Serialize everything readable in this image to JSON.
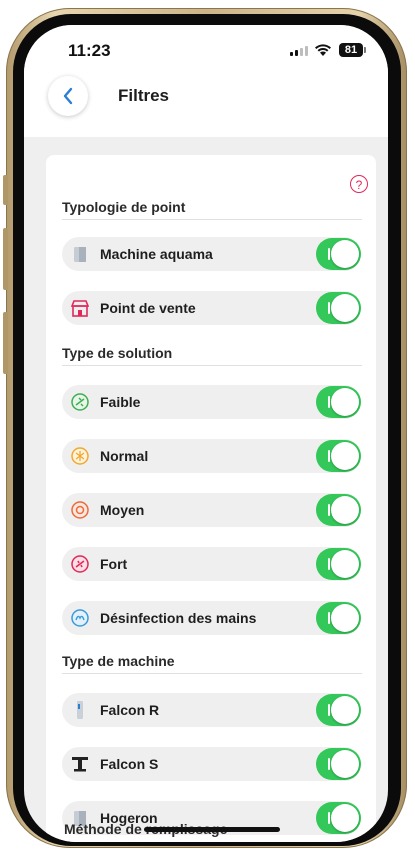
{
  "status_bar": {
    "time": "11:23",
    "battery": "81"
  },
  "header": {
    "title": "Filtres"
  },
  "sections": [
    {
      "title": "Typologie de point",
      "items": [
        {
          "label": "Machine aquama",
          "icon": "machine-icon",
          "on": true
        },
        {
          "label": "Point de vente",
          "icon": "store-icon",
          "on": true
        }
      ]
    },
    {
      "title": "Type de solution",
      "items": [
        {
          "label": "Faible",
          "icon": "faible-icon",
          "on": true
        },
        {
          "label": "Normal",
          "icon": "normal-icon",
          "on": true
        },
        {
          "label": "Moyen",
          "icon": "moyen-icon",
          "on": true
        },
        {
          "label": "Fort",
          "icon": "fort-icon",
          "on": true
        },
        {
          "label": "Désinfection des mains",
          "icon": "hands-icon",
          "on": true
        }
      ]
    },
    {
      "title": "Type de machine",
      "items": [
        {
          "label": "Falcon R",
          "icon": "falcon-r-icon",
          "on": true
        },
        {
          "label": "Falcon S",
          "icon": "falcon-s-icon",
          "on": true
        },
        {
          "label": "Hogeron",
          "icon": "hogeron-icon",
          "on": true
        }
      ]
    },
    {
      "title": "Méthode de remplissage",
      "items": []
    }
  ],
  "colors": {
    "toggle_on": "#34c759",
    "accent_blue": "#2a7fd4",
    "help": "#e0285a"
  }
}
